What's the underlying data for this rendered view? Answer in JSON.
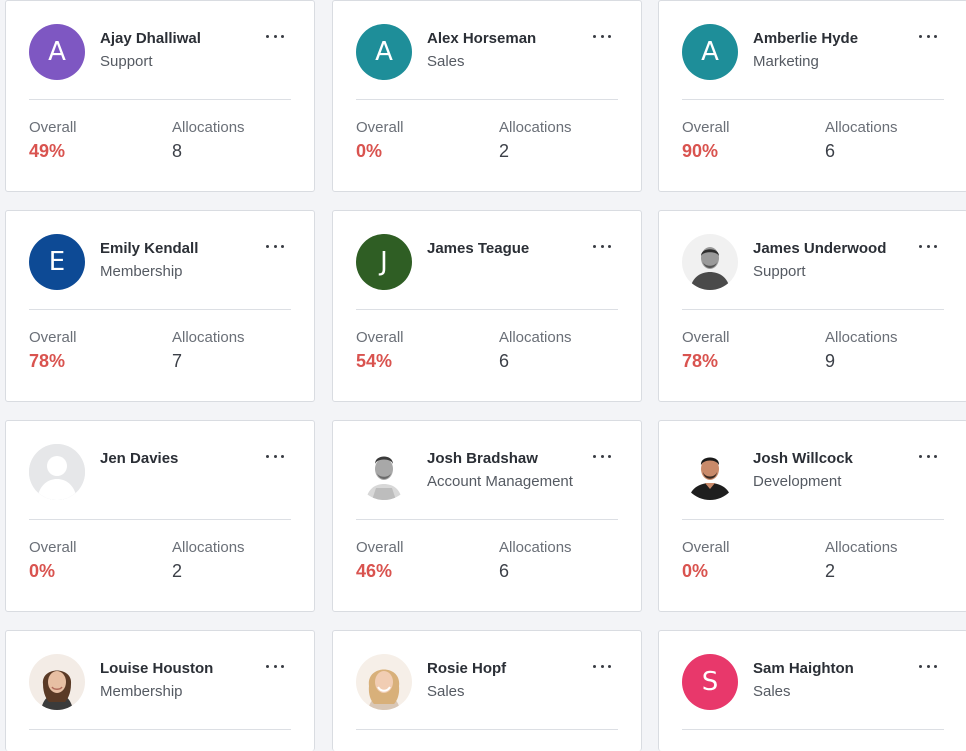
{
  "labels": {
    "overall": "Overall",
    "allocations": "Allocations"
  },
  "colors": {
    "overall_value": "#d9534f",
    "avatar_purple": "#7e57c2",
    "avatar_teal": "#1e8e99",
    "avatar_blue": "#0d4a95",
    "avatar_green": "#2f5e24",
    "avatar_pink": "#e8386b"
  },
  "cards": [
    {
      "name": "Ajay Dhalliwal",
      "department": "Support",
      "avatar_letter": "A",
      "overall": "49%",
      "allocations": "8"
    },
    {
      "name": "Alex Horseman",
      "department": "Sales",
      "avatar_letter": "A",
      "overall": "0%",
      "allocations": "2"
    },
    {
      "name": "Amberlie Hyde",
      "department": "Marketing",
      "avatar_letter": "A",
      "overall": "90%",
      "allocations": "6"
    },
    {
      "name": "Emily Kendall",
      "department": "Membership",
      "avatar_letter": "E",
      "overall": "78%",
      "allocations": "7"
    },
    {
      "name": "James Teague",
      "department": "",
      "avatar_letter": "J",
      "overall": "54%",
      "allocations": "6"
    },
    {
      "name": "James Underwood",
      "department": "Support",
      "avatar_icon": "user-photo",
      "overall": "78%",
      "allocations": "9"
    },
    {
      "name": "Jen Davies",
      "department": "",
      "avatar_icon": "default-user-placeholder",
      "overall": "0%",
      "allocations": "2"
    },
    {
      "name": "Josh Bradshaw",
      "department": "Account Management",
      "avatar_icon": "user-photo",
      "overall": "46%",
      "allocations": "6"
    },
    {
      "name": "Josh Willcock",
      "department": "Development",
      "avatar_icon": "user-photo",
      "overall": "0%",
      "allocations": "2"
    },
    {
      "name": "Louise Houston",
      "department": "Membership",
      "avatar_icon": "user-photo"
    },
    {
      "name": "Rosie Hopf",
      "department": "Sales",
      "avatar_icon": "user-photo"
    },
    {
      "name": "Sam Haighton",
      "department": "Sales",
      "avatar_letter": "S"
    }
  ]
}
